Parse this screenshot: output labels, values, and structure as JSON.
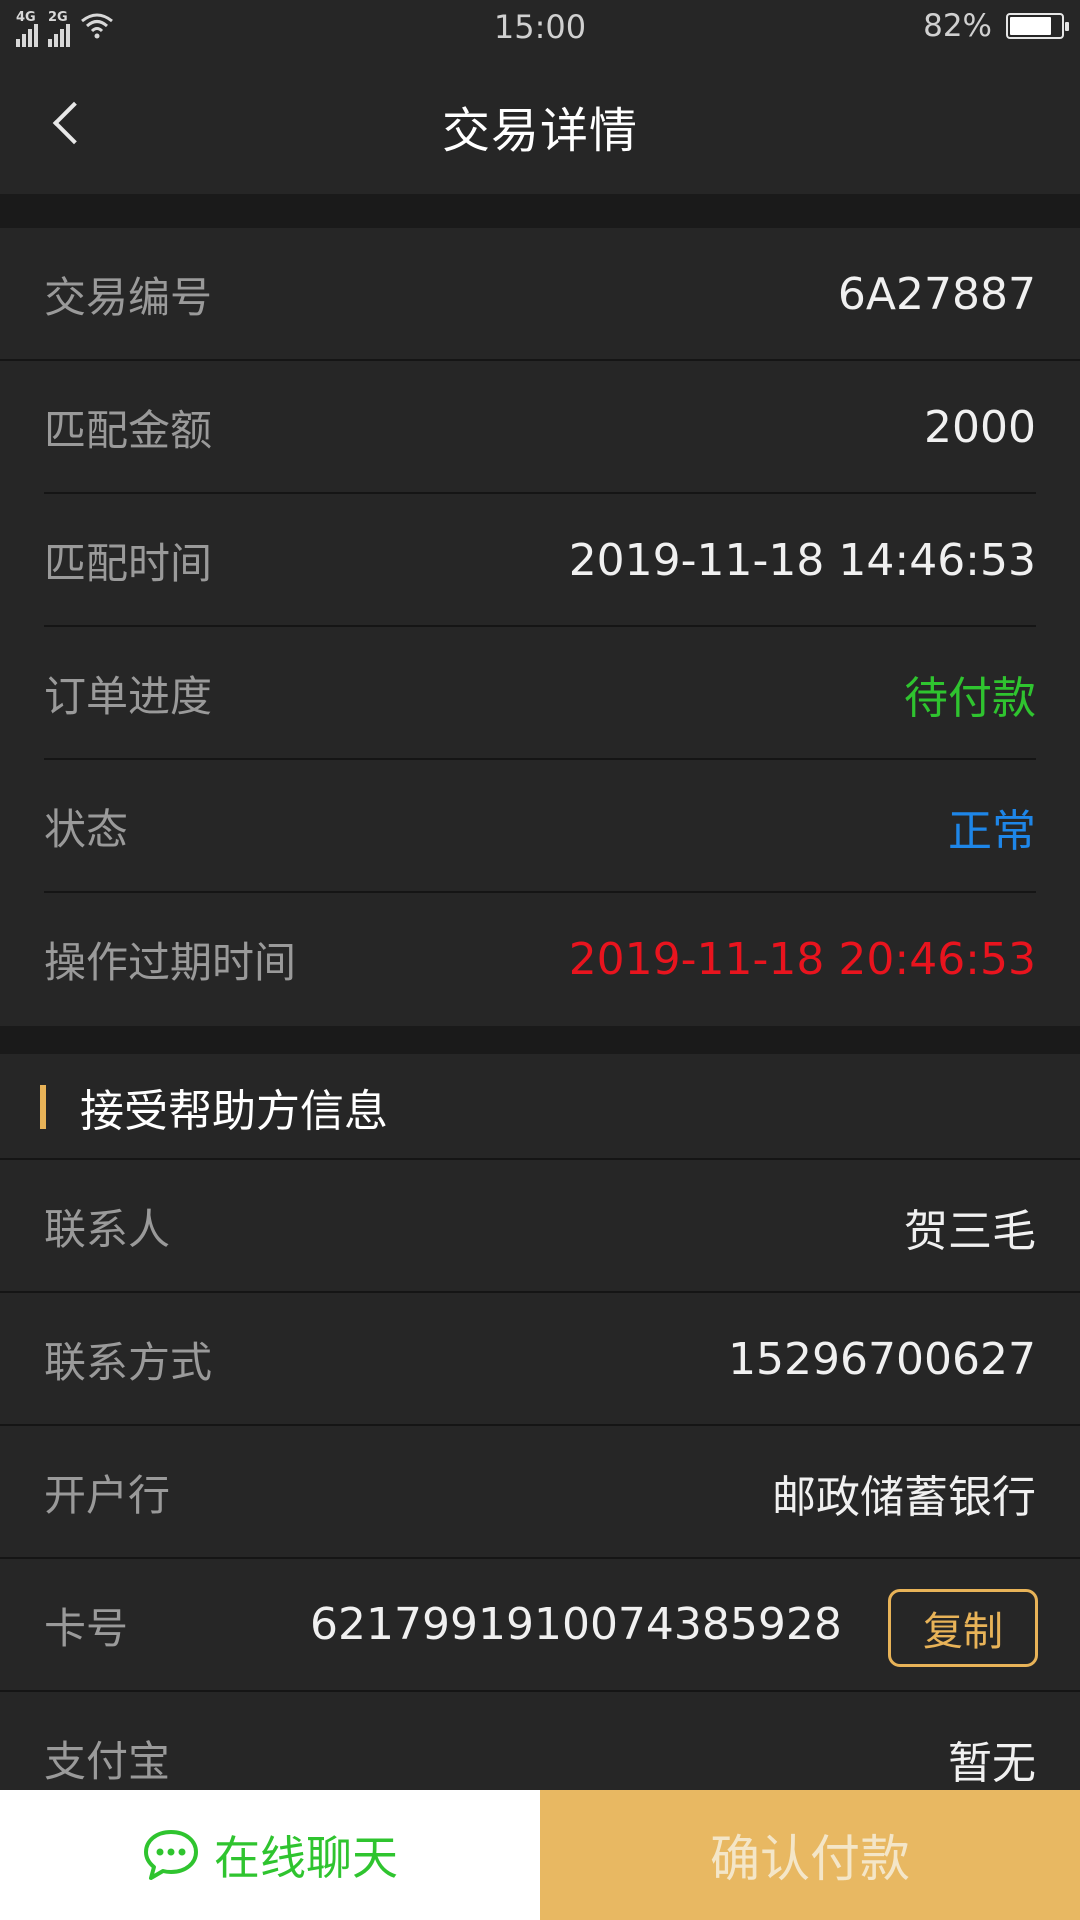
{
  "status_bar": {
    "signal1_tag": "4G",
    "signal2_tag": "2G",
    "time": "15:00",
    "battery_text": "82%",
    "battery_level": 0.82
  },
  "nav": {
    "title": "交易详情"
  },
  "transaction": {
    "rows": [
      {
        "label": "交易编号",
        "value": "6A27887"
      },
      {
        "label": "匹配金额",
        "value": "2000"
      },
      {
        "label": "匹配时间",
        "value": "2019-11-18 14:46:53"
      },
      {
        "label": "订单进度",
        "value": "待付款",
        "color": "#2fc42f"
      },
      {
        "label": "状态",
        "value": "正常",
        "color": "#1e86e8"
      },
      {
        "label": "操作过期时间",
        "value": "2019-11-18 20:46:53",
        "color": "#e8141e"
      }
    ]
  },
  "recipient": {
    "section_title": "接受帮助方信息",
    "rows": [
      {
        "label": "联系人",
        "value": "贺三毛"
      },
      {
        "label": "联系方式",
        "value": "15296700627"
      },
      {
        "label": "开户行",
        "value": "邮政储蓄银行"
      },
      {
        "label": "卡号",
        "value": "6217991910074385928"
      },
      {
        "label": "支付宝",
        "value": "暂无"
      }
    ],
    "copy_label": "复制"
  },
  "bottom": {
    "chat_label": "在线聊天",
    "confirm_label": "确认付款"
  },
  "colors": {
    "accent": "#e8b358",
    "success": "#2fc42f",
    "info": "#1e86e8",
    "danger": "#e8141e"
  }
}
